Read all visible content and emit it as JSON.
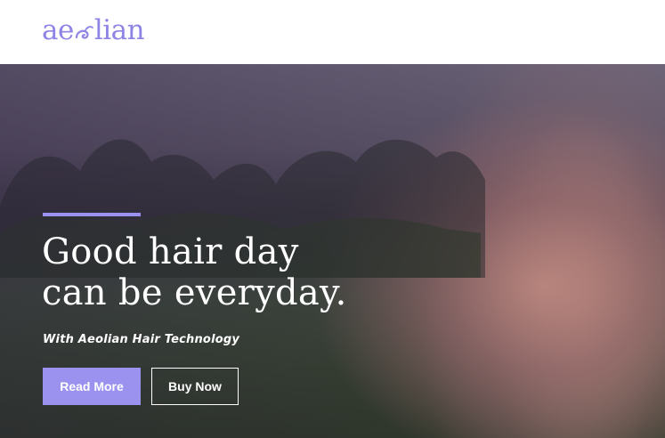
{
  "brand": {
    "logo_prefix": "ae",
    "logo_suffix": "lian",
    "logo_text": "aeolian",
    "color": "#8e84e6"
  },
  "hero": {
    "headline_line1": "Good hair day",
    "headline_line2": "can be everyday.",
    "subtitle": "With Aeolian Hair Technology",
    "accent_color": "#9b92ef",
    "primary_button": "Read More",
    "secondary_button": "Buy Now",
    "background_image": "girl-hair-field-photo"
  }
}
